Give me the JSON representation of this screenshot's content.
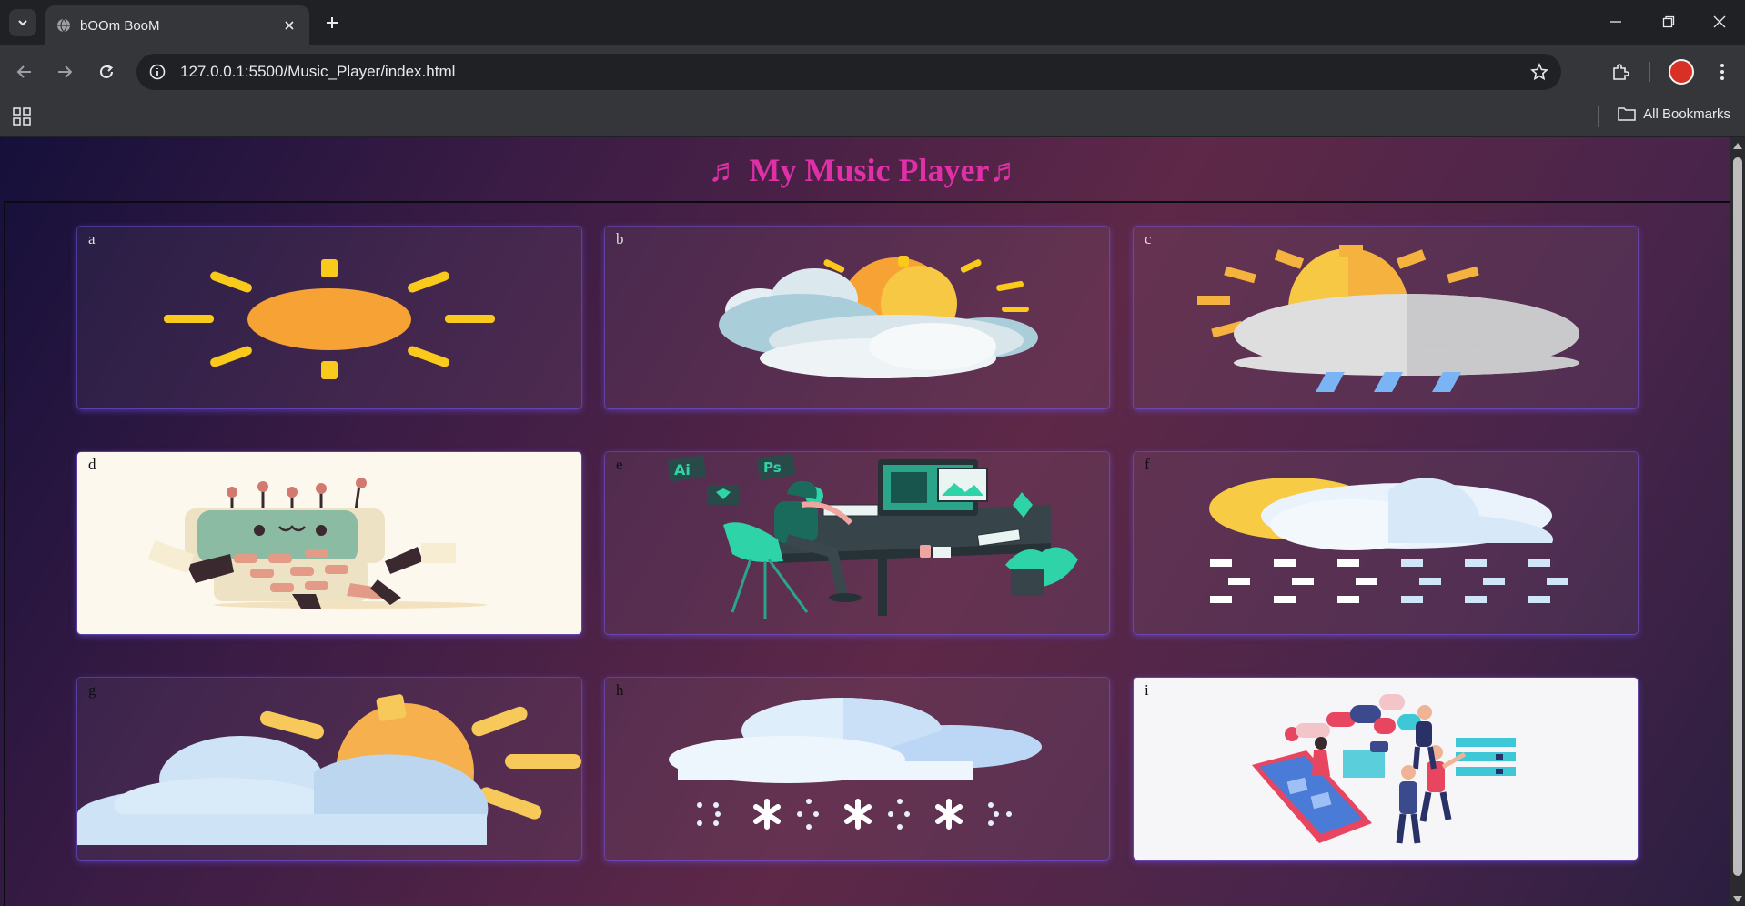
{
  "browser": {
    "tab_title": "bOOm BooM",
    "url": "127.0.0.1:5500/Music_Player/index.html",
    "bookmarks_label": "All Bookmarks"
  },
  "page": {
    "title": "♬ My Music Player♬"
  },
  "cards": [
    {
      "label": "a",
      "art": "sun"
    },
    {
      "label": "b",
      "art": "sun-behind-clouds"
    },
    {
      "label": "c",
      "art": "sun-cloud-rain"
    },
    {
      "label": "d",
      "art": "robot"
    },
    {
      "label": "e",
      "art": "designer-desk"
    },
    {
      "label": "f",
      "art": "sun-cloud-sleet"
    },
    {
      "label": "g",
      "art": "sun-cloud"
    },
    {
      "label": "h",
      "art": "cloud-snow"
    },
    {
      "label": "i",
      "art": "social-media-people"
    }
  ]
}
